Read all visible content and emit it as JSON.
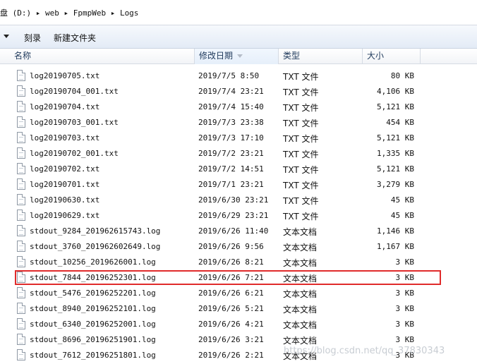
{
  "address_bar": {
    "path": "盘 (D:) ▸ web ▸ FpmpWeb ▸ Logs"
  },
  "toolbar": {
    "burn_label": "刻录",
    "new_folder_label": "新建文件夹"
  },
  "columns": {
    "name": "名称",
    "date_modified": "修改日期",
    "type": "类型",
    "size": "大小"
  },
  "files": [
    {
      "name": "log20190705.txt",
      "date": "2019/7/5 8:50",
      "type": "TXT 文件",
      "size": "80 KB"
    },
    {
      "name": "log20190704_001.txt",
      "date": "2019/7/4 23:21",
      "type": "TXT 文件",
      "size": "4,106 KB"
    },
    {
      "name": "log20190704.txt",
      "date": "2019/7/4 15:40",
      "type": "TXT 文件",
      "size": "5,121 KB"
    },
    {
      "name": "log20190703_001.txt",
      "date": "2019/7/3 23:38",
      "type": "TXT 文件",
      "size": "454 KB"
    },
    {
      "name": "log20190703.txt",
      "date": "2019/7/3 17:10",
      "type": "TXT 文件",
      "size": "5,121 KB"
    },
    {
      "name": "log20190702_001.txt",
      "date": "2019/7/2 23:21",
      "type": "TXT 文件",
      "size": "1,335 KB"
    },
    {
      "name": "log20190702.txt",
      "date": "2019/7/2 14:51",
      "type": "TXT 文件",
      "size": "5,121 KB"
    },
    {
      "name": "log20190701.txt",
      "date": "2019/7/1 23:21",
      "type": "TXT 文件",
      "size": "3,279 KB"
    },
    {
      "name": "log20190630.txt",
      "date": "2019/6/30 23:21",
      "type": "TXT 文件",
      "size": "45 KB"
    },
    {
      "name": "log20190629.txt",
      "date": "2019/6/29 23:21",
      "type": "TXT 文件",
      "size": "45 KB"
    },
    {
      "name": "stdout_9284_201962615743.log",
      "date": "2019/6/26 11:40",
      "type": "文本文档",
      "size": "1,146 KB"
    },
    {
      "name": "stdout_3760_201962602649.log",
      "date": "2019/6/26 9:56",
      "type": "文本文档",
      "size": "1,167 KB"
    },
    {
      "name": "stdout_10256_2019626001.log",
      "date": "2019/6/26 8:21",
      "type": "文本文档",
      "size": "3 KB"
    },
    {
      "name": "stdout_7844_20196252301.log",
      "date": "2019/6/26 7:21",
      "type": "文本文档",
      "size": "3 KB",
      "highlighted": true
    },
    {
      "name": "stdout_5476_20196252201.log",
      "date": "2019/6/26 6:21",
      "type": "文本文档",
      "size": "3 KB"
    },
    {
      "name": "stdout_8940_20196252101.log",
      "date": "2019/6/26 5:21",
      "type": "文本文档",
      "size": "3 KB"
    },
    {
      "name": "stdout_6340_20196252001.log",
      "date": "2019/6/26 4:21",
      "type": "文本文档",
      "size": "3 KB"
    },
    {
      "name": "stdout_8696_20196251901.log",
      "date": "2019/6/26 3:21",
      "type": "文本文档",
      "size": "3 KB"
    },
    {
      "name": "stdout_7612_20196251801.log",
      "date": "2019/6/26 2:21",
      "type": "文本文档",
      "size": "3 KB"
    }
  ],
  "highlight_color": "#e02b2b",
  "watermark": "https://blog.csdn.net/qq_37830343"
}
